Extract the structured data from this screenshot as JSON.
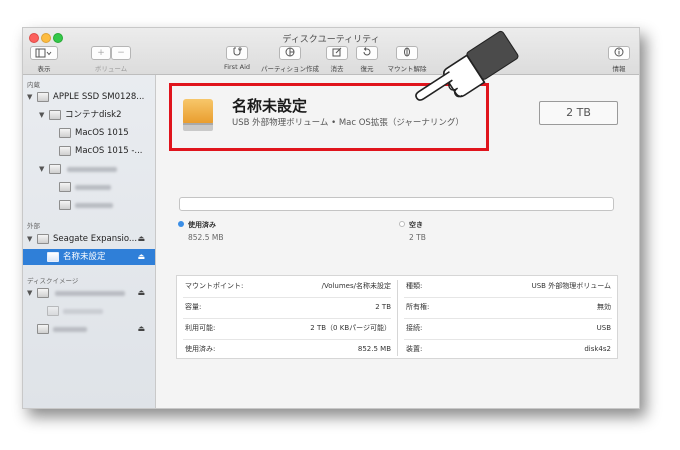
{
  "window": {
    "title": "ディスクユーティリティ"
  },
  "toolbar": {
    "view_label": "表示",
    "volume_label": "ボリューム",
    "first_aid": "First Aid",
    "partition": "パーティション作成",
    "erase": "消去",
    "restore": "復元",
    "unmount": "マウント解除",
    "info": "情報",
    "plus": "+",
    "minus": "−"
  },
  "sidebar": {
    "section_internal": "内蔵",
    "internal_disk": "APPLE SSD SM0128...",
    "container": "コンテナdisk2",
    "vol1": "MacOS 1015",
    "vol2": "MacOS 1015 -...",
    "section_external": "外部",
    "external_disk": "Seagate Expansio...",
    "selected_volume": "名称未設定",
    "section_images": "ディスクイメージ",
    "eject_icon": "eject-icon"
  },
  "volume": {
    "name": "名称未設定",
    "description": "USB 外部物理ボリューム • Mac OS拡張（ジャーナリング）",
    "size": "2 TB"
  },
  "usage": {
    "used_label": "使用済み",
    "used_value": "852.5 MB",
    "used_color": "#3a8ee6",
    "free_label": "空き",
    "free_value": "2 TB",
    "free_color": "#ffffff"
  },
  "info": {
    "left": [
      {
        "key": "マウントポイント:",
        "value": "/Volumes/名称未設定"
      },
      {
        "key": "容量:",
        "value": "2 TB"
      },
      {
        "key": "利用可能:",
        "value": "2 TB（0 KBパージ可能）"
      },
      {
        "key": "使用済み:",
        "value": "852.5 MB"
      }
    ],
    "right": [
      {
        "key": "種類:",
        "value": "USB 外部物理ボリューム"
      },
      {
        "key": "所有権:",
        "value": "無効"
      },
      {
        "key": "接続:",
        "value": "USB"
      },
      {
        "key": "装置:",
        "value": "disk4s2"
      }
    ]
  },
  "colors": {
    "highlight": "#e0141c",
    "selection": "#2f7fd8"
  }
}
